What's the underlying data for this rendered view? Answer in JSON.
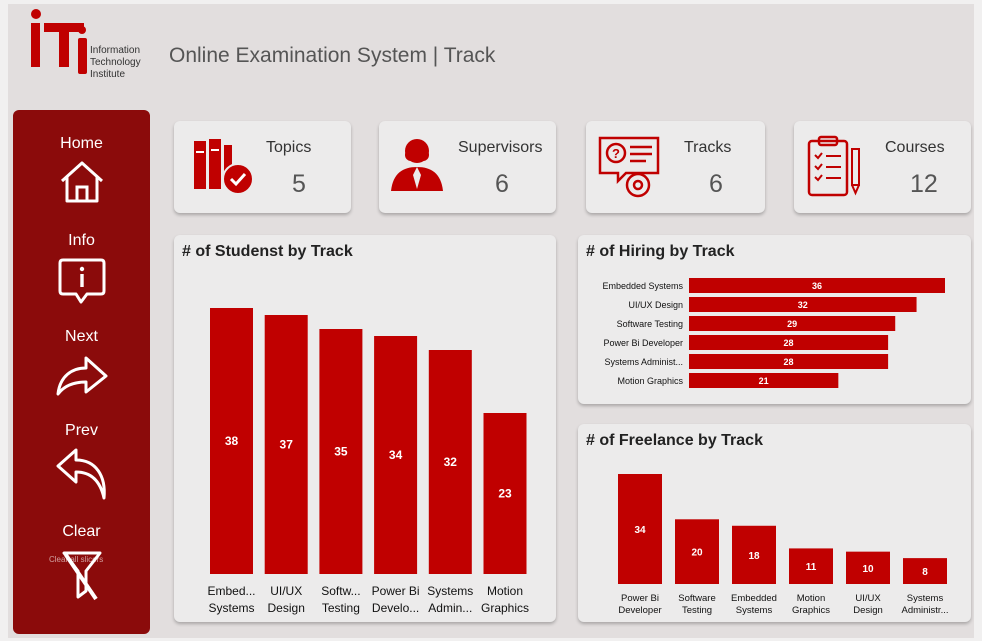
{
  "header": {
    "title": "Online Examination System | Track",
    "logo_lines": [
      "Information",
      "Technology",
      "Institute"
    ]
  },
  "sidebar": {
    "items": [
      {
        "label": "Home",
        "icon": "home-icon"
      },
      {
        "label": "Info",
        "icon": "info-bubble-icon"
      },
      {
        "label": "Next",
        "icon": "forward-arrow-icon"
      },
      {
        "label": "Prev",
        "icon": "reply-arrow-icon"
      },
      {
        "label": "Clear",
        "icon": "filter-clear-icon"
      }
    ],
    "clear_tooltip": "Clear all slicers"
  },
  "kpis": [
    {
      "label": "Topics",
      "value": "5",
      "icon": "books-check-icon"
    },
    {
      "label": "Supervisors",
      "value": "6",
      "icon": "person-icon"
    },
    {
      "label": "Tracks",
      "value": "6",
      "icon": "question-chat-icon"
    },
    {
      "label": "Courses",
      "value": "12",
      "icon": "clipboard-checklist-icon"
    }
  ],
  "colors": {
    "accent": "#c00000",
    "sidebar": "#8b0b0b"
  },
  "chart_data": [
    {
      "type": "bar",
      "title": "# of Studenst by Track",
      "categories": [
        [
          "Embed...",
          "Systems"
        ],
        [
          "UI/UX",
          "Design"
        ],
        [
          "Softw...",
          "Testing"
        ],
        [
          "Power Bi",
          "Develo..."
        ],
        [
          "Systems",
          "Admin..."
        ],
        [
          "Motion",
          "Graphics"
        ]
      ],
      "values": [
        38,
        37,
        35,
        34,
        32,
        23
      ],
      "ylim": [
        0,
        40
      ]
    },
    {
      "type": "bar",
      "orientation": "horizontal",
      "title": "# of Hiring by Track",
      "categories": [
        "Embedded Systems",
        "UI/UX Design",
        "Software Testing",
        "Power Bi Developer",
        "Systems Administ...",
        "Motion Graphics"
      ],
      "values": [
        36,
        32,
        29,
        28,
        28,
        21
      ],
      "xlim": [
        0,
        36
      ]
    },
    {
      "type": "bar",
      "title": "# of Freelance by Track",
      "categories": [
        [
          "Power Bi",
          "Developer"
        ],
        [
          "Software",
          "Testing"
        ],
        [
          "Embedded",
          "Systems"
        ],
        [
          "Motion",
          "Graphics"
        ],
        [
          "UI/UX",
          "Design"
        ],
        [
          "Systems",
          "Administr..."
        ]
      ],
      "values": [
        34,
        20,
        18,
        11,
        10,
        8
      ],
      "ylim": [
        0,
        34
      ]
    }
  ]
}
